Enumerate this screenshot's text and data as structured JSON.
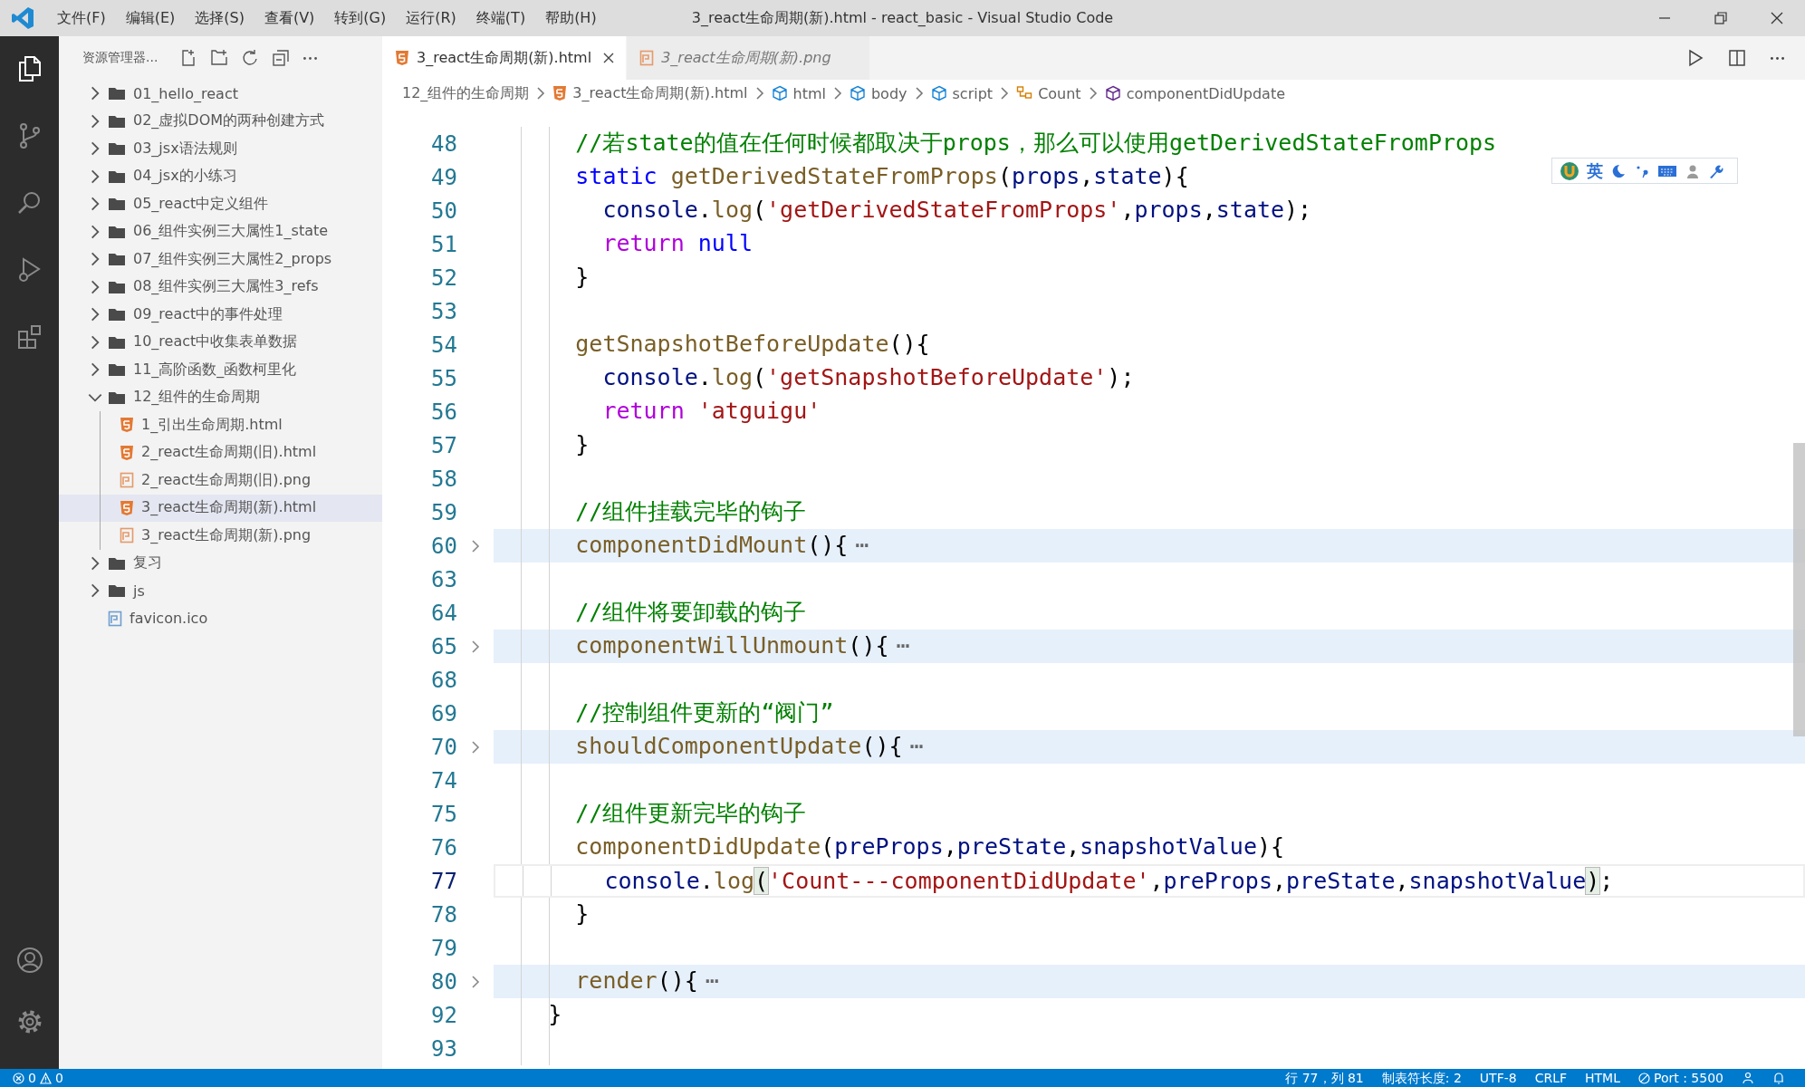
{
  "title_bar": {
    "menus": [
      "文件(F)",
      "编辑(E)",
      "选择(S)",
      "查看(V)",
      "转到(G)",
      "运行(R)",
      "终端(T)",
      "帮助(H)"
    ],
    "title": "3_react生命周期(新).html - react_basic - Visual Studio Code"
  },
  "explorer": {
    "title": "资源管理器...",
    "tree": [
      {
        "label": "01_hello_react",
        "kind": "folder",
        "expanded": false,
        "selected": false
      },
      {
        "label": "02_虚拟DOM的两种创建方式",
        "kind": "folder",
        "expanded": false,
        "selected": false
      },
      {
        "label": "03_jsx语法规则",
        "kind": "folder",
        "expanded": false,
        "selected": false
      },
      {
        "label": "04_jsx的小练习",
        "kind": "folder",
        "expanded": false,
        "selected": false
      },
      {
        "label": "05_react中定义组件",
        "kind": "folder",
        "expanded": false,
        "selected": false
      },
      {
        "label": "06_组件实例三大属性1_state",
        "kind": "folder",
        "expanded": false,
        "selected": false
      },
      {
        "label": "07_组件实例三大属性2_props",
        "kind": "folder",
        "expanded": false,
        "selected": false
      },
      {
        "label": "08_组件实例三大属性3_refs",
        "kind": "folder",
        "expanded": false,
        "selected": false
      },
      {
        "label": "09_react中的事件处理",
        "kind": "folder",
        "expanded": false,
        "selected": false
      },
      {
        "label": "10_react中收集表单数据",
        "kind": "folder",
        "expanded": false,
        "selected": false
      },
      {
        "label": "11_高阶函数_函数柯里化",
        "kind": "folder",
        "expanded": false,
        "selected": false
      },
      {
        "label": "12_组件的生命周期",
        "kind": "folder",
        "expanded": true,
        "selected": false,
        "children": [
          {
            "label": "1_引出生命周期.html",
            "kind": "html",
            "selected": false
          },
          {
            "label": "2_react生命周期(旧).html",
            "kind": "html",
            "selected": false
          },
          {
            "label": "2_react生命周期(旧).png",
            "kind": "png",
            "selected": false
          },
          {
            "label": "3_react生命周期(新).html",
            "kind": "html",
            "selected": true
          },
          {
            "label": "3_react生命周期(新).png",
            "kind": "png",
            "selected": false
          }
        ]
      },
      {
        "label": "复习",
        "kind": "folder",
        "expanded": false,
        "selected": false
      },
      {
        "label": "js",
        "kind": "folder",
        "expanded": false,
        "selected": false
      },
      {
        "label": "favicon.ico",
        "kind": "ico",
        "selected": false
      }
    ]
  },
  "tabs": [
    {
      "label": "3_react生命周期(新).html",
      "kind": "html",
      "selected": true,
      "preview": false
    },
    {
      "label": "3_react生命周期(新).png",
      "kind": "png",
      "selected": false,
      "preview": true
    }
  ],
  "breadcrumbs": [
    {
      "label": "12_组件的生命周期",
      "kind": "folder"
    },
    {
      "label": "3_react生命周期(新).html",
      "kind": "html"
    },
    {
      "label": "html",
      "kind": "element"
    },
    {
      "label": "body",
      "kind": "element"
    },
    {
      "label": "script",
      "kind": "element"
    },
    {
      "label": "Count",
      "kind": "class"
    },
    {
      "label": "componentDidUpdate",
      "kind": "method"
    }
  ],
  "ime_toolbar": {
    "mode": "英"
  },
  "lines": [
    {
      "number": "48",
      "folded": false,
      "current": false,
      "tokens": [
        {
          "kind": "comment",
          "text": "      //若state的值在任何时候都取决于props，那么可以使用getDerivedStateFromProps"
        }
      ]
    },
    {
      "number": "49",
      "folded": false,
      "current": false,
      "tokens": [
        {
          "kind": "keyword",
          "text": "      static"
        },
        {
          "kind": "function",
          "text": " getDerivedStateFromProps"
        },
        {
          "kind": "plain",
          "text": "("
        },
        {
          "kind": "variable",
          "text": "props"
        },
        {
          "kind": "plain",
          "text": ","
        },
        {
          "kind": "variable",
          "text": "state"
        },
        {
          "kind": "plain",
          "text": "){"
        }
      ]
    },
    {
      "number": "50",
      "folded": false,
      "current": false,
      "tokens": [
        {
          "kind": "variable",
          "text": "        console"
        },
        {
          "kind": "plain",
          "text": "."
        },
        {
          "kind": "function",
          "text": "log"
        },
        {
          "kind": "plain",
          "text": "("
        },
        {
          "kind": "string",
          "text": "'getDerivedStateFromProps'"
        },
        {
          "kind": "plain",
          "text": ","
        },
        {
          "kind": "variable",
          "text": "props"
        },
        {
          "kind": "plain",
          "text": ","
        },
        {
          "kind": "variable",
          "text": "state"
        },
        {
          "kind": "plain",
          "text": ");"
        }
      ]
    },
    {
      "number": "51",
      "folded": false,
      "current": false,
      "tokens": [
        {
          "kind": "control",
          "text": "        return"
        },
        {
          "kind": "keyword",
          "text": " null"
        }
      ]
    },
    {
      "number": "52",
      "folded": false,
      "current": false,
      "tokens": [
        {
          "kind": "plain",
          "text": "      }"
        }
      ]
    },
    {
      "number": "53",
      "folded": false,
      "current": false
    },
    {
      "number": "54",
      "folded": false,
      "current": false,
      "tokens": [
        {
          "kind": "function",
          "text": "      getSnapshotBeforeUpdate"
        },
        {
          "kind": "plain",
          "text": "(){"
        }
      ]
    },
    {
      "number": "55",
      "folded": false,
      "current": false,
      "tokens": [
        {
          "kind": "variable",
          "text": "        console"
        },
        {
          "kind": "plain",
          "text": "."
        },
        {
          "kind": "function",
          "text": "log"
        },
        {
          "kind": "plain",
          "text": "("
        },
        {
          "kind": "string",
          "text": "'getSnapshotBeforeUpdate'"
        },
        {
          "kind": "plain",
          "text": ");"
        }
      ]
    },
    {
      "number": "56",
      "folded": false,
      "current": false,
      "tokens": [
        {
          "kind": "control",
          "text": "        return"
        },
        {
          "kind": "string",
          "text": " 'atguigu'"
        }
      ]
    },
    {
      "number": "57",
      "folded": false,
      "current": false,
      "tokens": [
        {
          "kind": "plain",
          "text": "      }"
        }
      ]
    },
    {
      "number": "58",
      "folded": false,
      "current": false
    },
    {
      "number": "59",
      "folded": false,
      "current": false,
      "tokens": [
        {
          "kind": "comment",
          "text": "      //组件挂载完毕的钩子"
        }
      ]
    },
    {
      "number": "60",
      "folded": true,
      "current": false,
      "tokens": [
        {
          "kind": "function",
          "text": "      componentDidMount"
        },
        {
          "kind": "plain",
          "text": "(){"
        },
        {
          "kind": "fold",
          "text": "⋯"
        }
      ]
    },
    {
      "number": "63",
      "folded": false,
      "current": false
    },
    {
      "number": "64",
      "folded": false,
      "current": false,
      "tokens": [
        {
          "kind": "comment",
          "text": "      //组件将要卸载的钩子"
        }
      ]
    },
    {
      "number": "65",
      "folded": true,
      "current": false,
      "tokens": [
        {
          "kind": "function",
          "text": "      componentWillUnmount"
        },
        {
          "kind": "plain",
          "text": "(){"
        },
        {
          "kind": "fold",
          "text": "⋯"
        }
      ]
    },
    {
      "number": "68",
      "folded": false,
      "current": false
    },
    {
      "number": "69",
      "folded": false,
      "current": false,
      "tokens": [
        {
          "kind": "comment",
          "text": "      //控制组件更新的“阀门”"
        }
      ]
    },
    {
      "number": "70",
      "folded": true,
      "current": false,
      "tokens": [
        {
          "kind": "function",
          "text": "      shouldComponentUpdate"
        },
        {
          "kind": "plain",
          "text": "(){"
        },
        {
          "kind": "fold",
          "text": "⋯"
        }
      ]
    },
    {
      "number": "74",
      "folded": false,
      "current": false
    },
    {
      "number": "75",
      "folded": false,
      "current": false,
      "tokens": [
        {
          "kind": "comment",
          "text": "      //组件更新完毕的钩子"
        }
      ]
    },
    {
      "number": "76",
      "folded": false,
      "current": false,
      "tokens": [
        {
          "kind": "function",
          "text": "      componentDidUpdate"
        },
        {
          "kind": "plain",
          "text": "("
        },
        {
          "kind": "variable",
          "text": "preProps"
        },
        {
          "kind": "plain",
          "text": ","
        },
        {
          "kind": "variable",
          "text": "preState"
        },
        {
          "kind": "plain",
          "text": ","
        },
        {
          "kind": "variable",
          "text": "snapshotValue"
        },
        {
          "kind": "plain",
          "text": "){"
        }
      ]
    },
    {
      "number": "77",
      "folded": false,
      "current": true,
      "tokens": [
        {
          "kind": "variable",
          "text": "        console"
        },
        {
          "kind": "plain",
          "text": "."
        },
        {
          "kind": "function",
          "text": "log"
        },
        {
          "kind": "bracket",
          "text": "("
        },
        {
          "kind": "string",
          "text": "'Count---componentDidUpdate'"
        },
        {
          "kind": "plain",
          "text": ","
        },
        {
          "kind": "variable",
          "text": "preProps"
        },
        {
          "kind": "plain",
          "text": ","
        },
        {
          "kind": "variable",
          "text": "preState"
        },
        {
          "kind": "plain",
          "text": ","
        },
        {
          "kind": "variable",
          "text": "snapshotValue"
        },
        {
          "kind": "bracket",
          "text": ")"
        },
        {
          "kind": "plain",
          "text": ";"
        }
      ]
    },
    {
      "number": "78",
      "folded": false,
      "current": false,
      "tokens": [
        {
          "kind": "plain",
          "text": "      }"
        }
      ]
    },
    {
      "number": "79",
      "folded": false,
      "current": false
    },
    {
      "number": "80",
      "folded": true,
      "current": false,
      "tokens": [
        {
          "kind": "function",
          "text": "      render"
        },
        {
          "kind": "plain",
          "text": "(){"
        },
        {
          "kind": "fold",
          "text": "⋯"
        }
      ]
    },
    {
      "number": "92",
      "folded": false,
      "current": false,
      "tokens": [
        {
          "kind": "plain",
          "text": "    }"
        }
      ]
    },
    {
      "number": "93",
      "folded": false,
      "current": false
    }
  ],
  "status_bar": {
    "left": [
      {
        "kind": "errors",
        "text": "0"
      },
      {
        "kind": "warnings",
        "text": "0"
      }
    ],
    "right": [
      {
        "kind": "text",
        "text": "行 77，列 81"
      },
      {
        "kind": "text",
        "text": "制表符长度: 2"
      },
      {
        "kind": "text",
        "text": "UTF-8"
      },
      {
        "kind": "text",
        "text": "CRLF"
      },
      {
        "kind": "text",
        "text": "HTML"
      },
      {
        "kind": "port",
        "text": "Port : 5500"
      }
    ]
  }
}
